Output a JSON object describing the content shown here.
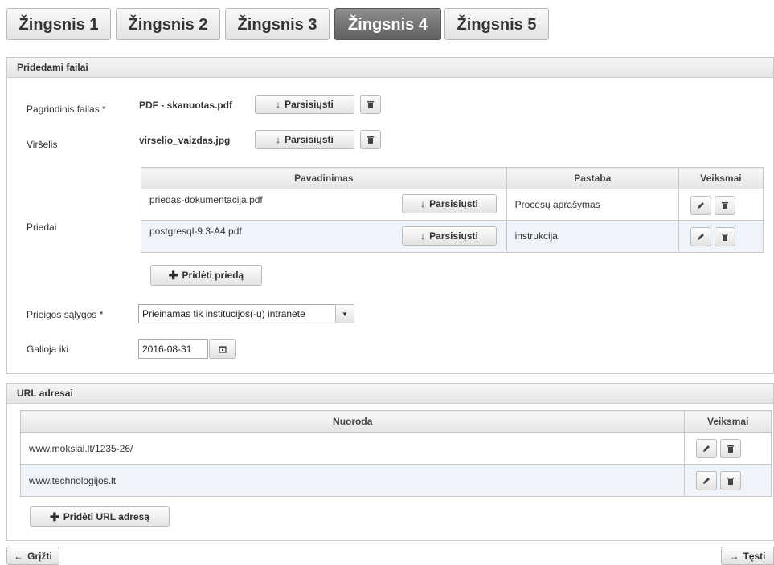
{
  "steps": [
    "Žingsnis 1",
    "Žingsnis 2",
    "Žingsnis 3",
    "Žingsnis 4",
    "Žingsnis 5"
  ],
  "active_step_index": 3,
  "files_panel": {
    "title": "Pridedami failai",
    "main_file": {
      "label": "Pagrindinis failas *",
      "name": "PDF - skanuotas.pdf",
      "download": "Parsisiųsti"
    },
    "cover": {
      "label": "Viršelis",
      "name": "virselio_vaizdas.jpg",
      "download": "Parsisiųsti"
    },
    "attachments": {
      "label": "Priedai",
      "columns": [
        "Pavadinimas",
        "Pastaba",
        "Veiksmai"
      ],
      "rows": [
        {
          "name": "priedas-dokumentacija.pdf",
          "download": "Parsisiųsti",
          "note": "Procesų aprašymas"
        },
        {
          "name": "postgresql-9.3-A4.pdf",
          "download": "Parsisiųsti",
          "note": "instrukcija"
        }
      ],
      "add_label": "Pridėti priedą"
    },
    "access": {
      "label": "Prieigos sąlygos *",
      "value": "Prieinamas tik institucijos(-ų) intranete"
    },
    "valid_until": {
      "label": "Galioja iki",
      "value": "2016-08-31"
    }
  },
  "url_panel": {
    "title": "URL adresai",
    "columns": [
      "Nuoroda",
      "Veiksmai"
    ],
    "rows": [
      "www.mokslai.lt/1235-26/",
      "www.technologijos.lt"
    ],
    "add_label": "Pridėti URL adresą"
  },
  "nav": {
    "back": "Grįžti",
    "next": "Tęsti"
  },
  "icons": {
    "download": "arrow-down-icon",
    "delete": "trash-icon",
    "edit": "pencil-icon",
    "add": "plus-icon",
    "calendar": "calendar-icon",
    "dropdown": "caret-down-icon",
    "back": "arrow-left-icon",
    "next": "arrow-right-icon"
  }
}
